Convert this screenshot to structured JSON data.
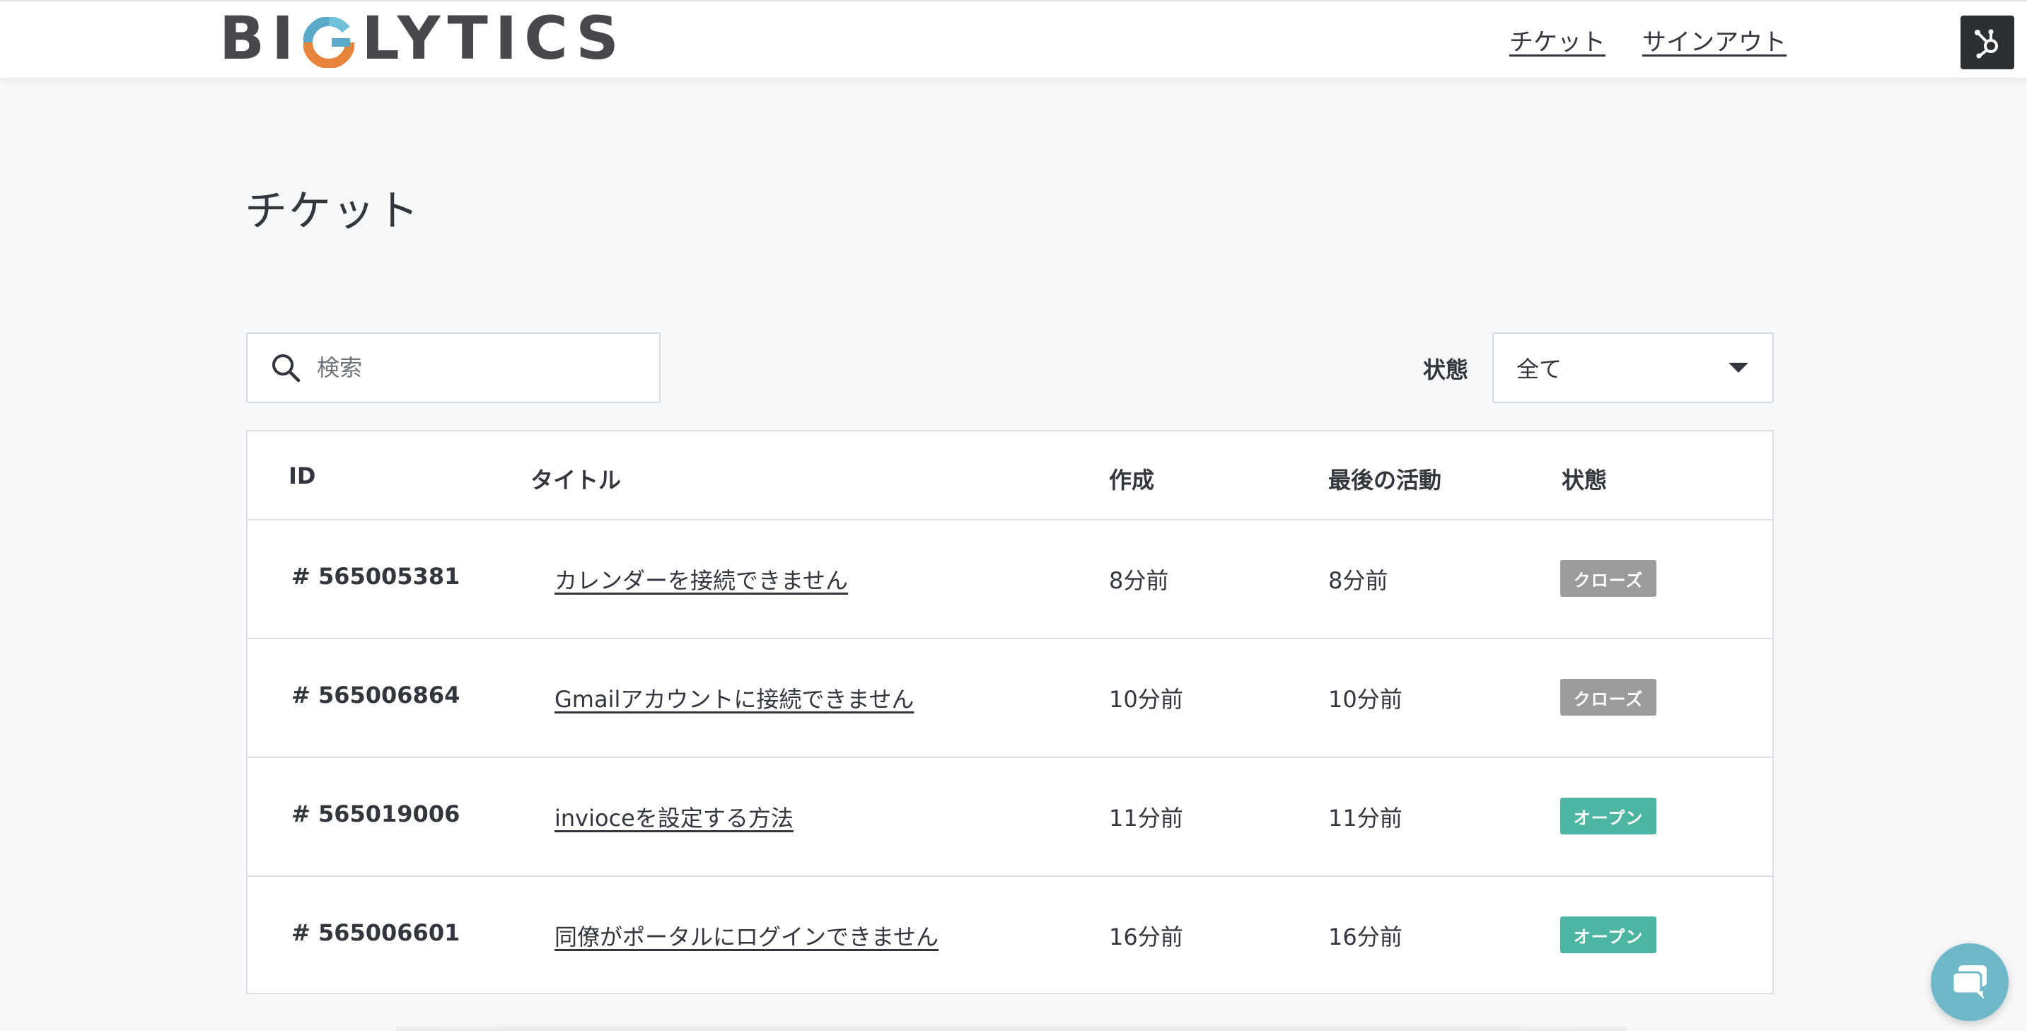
{
  "brand": {
    "logo_left": "BI",
    "logo_right": "LYTICS",
    "text_color": "#46484c",
    "accent_orange": "#e8833a",
    "accent_teal": "#5aa9c9"
  },
  "nav": {
    "tickets": "チケット",
    "signout": "サインアウト",
    "badge_icon": "hubspot-sprocket-icon"
  },
  "page": {
    "title": "チケット"
  },
  "search": {
    "placeholder": "検索",
    "value": "",
    "icon": "search-icon"
  },
  "filter": {
    "label": "状態",
    "selected": "全て",
    "icon": "caret-down-icon"
  },
  "table": {
    "headers": {
      "id": "ID",
      "title": "タイトル",
      "created": "作成",
      "activity": "最後の活動",
      "status": "状態"
    },
    "rows": [
      {
        "id": "# 565005381",
        "title": "カレンダーを接続できません",
        "created": "8分前",
        "activity": "8分前",
        "status": "クローズ",
        "status_color": "#9a9b9d"
      },
      {
        "id": "# 565006864",
        "title": "Gmailアカウントに接続できません",
        "created": "10分前",
        "activity": "10分前",
        "status": "クローズ",
        "status_color": "#9a9b9d"
      },
      {
        "id": "# 565019006",
        "title": "invioceを設定する方法",
        "created": "11分前",
        "activity": "11分前",
        "status": "オープン",
        "status_color": "#4fb5a3"
      },
      {
        "id": "# 565006601",
        "title": "同僚がポータルにログインできません",
        "created": "16分前",
        "activity": "16分前",
        "status": "オープン",
        "status_color": "#4fb5a3"
      }
    ]
  },
  "chat": {
    "icon": "chat-bubble-icon",
    "color": "#6fb8c9"
  }
}
